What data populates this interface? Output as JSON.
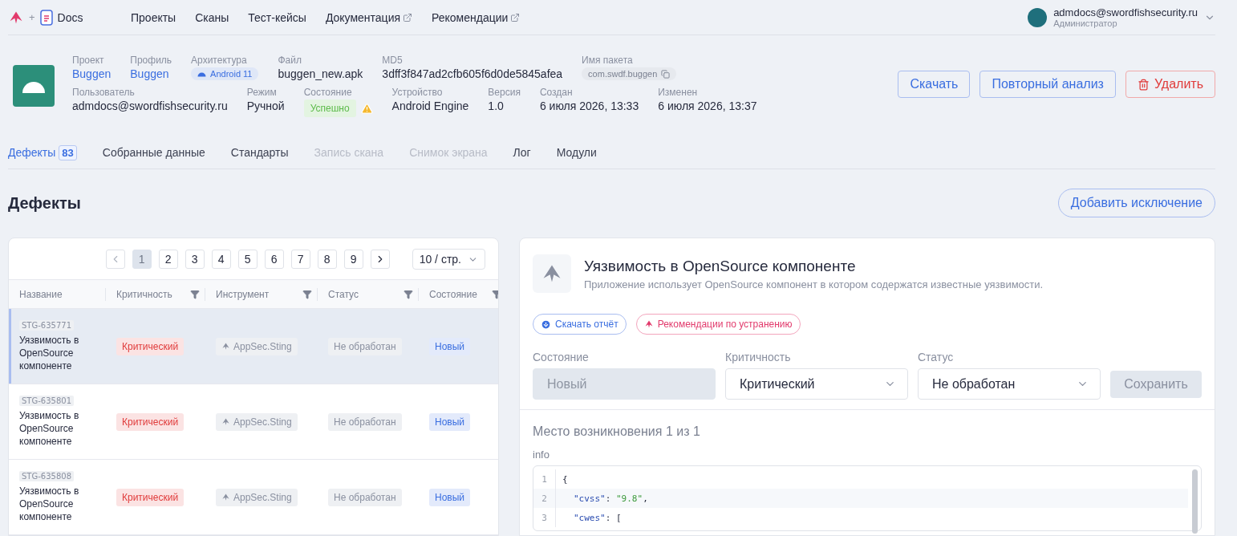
{
  "nav": {
    "separator": "+",
    "brand": "Docs",
    "items": [
      {
        "label": "Проекты",
        "external": false
      },
      {
        "label": "Сканы",
        "external": false
      },
      {
        "label": "Тест-кейсы",
        "external": false
      },
      {
        "label": "Документация",
        "external": true
      },
      {
        "label": "Рекомендации",
        "external": true
      }
    ],
    "user": {
      "email": "admdocs@swordfishsecurity.ru",
      "role": "Администратор"
    }
  },
  "scan": {
    "top": [
      {
        "label": "Проект",
        "value": "Buggen",
        "kind": "link"
      },
      {
        "label": "Профиль",
        "value": "Buggen",
        "kind": "link"
      },
      {
        "label": "Архитектура",
        "value": "Android 11",
        "kind": "platform"
      },
      {
        "label": "Файл",
        "value": "buggen_new.apk",
        "kind": "text"
      },
      {
        "label": "MD5",
        "value": "3dff3f847ad2cfb605f6d0de5845afea",
        "kind": "text"
      },
      {
        "label": "Имя пакета",
        "value": "com.swdf.buggen",
        "kind": "package"
      }
    ],
    "bottom": [
      {
        "label": "Пользователь",
        "value": "admdocs@swordfishsecurity.ru",
        "kind": "text"
      },
      {
        "label": "Режим",
        "value": "Ручной",
        "kind": "text"
      },
      {
        "label": "Состояние",
        "value": "Успешно",
        "kind": "status",
        "warning": true
      },
      {
        "label": "Устройство",
        "value": "Android Engine",
        "kind": "text"
      },
      {
        "label": "Версия",
        "value": "1.0",
        "kind": "text"
      },
      {
        "label": "Создан",
        "value": "6 июля 2026, 13:33",
        "kind": "text"
      },
      {
        "label": "Изменен",
        "value": "6 июля 2026, 13:37",
        "kind": "text"
      }
    ],
    "actions": [
      {
        "label": "Скачать",
        "kind": "primary"
      },
      {
        "label": "Повторный анализ",
        "kind": "primary"
      },
      {
        "label": "Удалить",
        "kind": "danger"
      }
    ]
  },
  "tabs": [
    {
      "label": "Дефекты",
      "count": "83",
      "selected": true,
      "disabled": false
    },
    {
      "label": "Собранные данные",
      "selected": false,
      "disabled": false
    },
    {
      "label": "Стандарты",
      "selected": false,
      "disabled": false
    },
    {
      "label": "Запись скана",
      "selected": false,
      "disabled": true
    },
    {
      "label": "Снимок экрана",
      "selected": false,
      "disabled": true
    },
    {
      "label": "Лог",
      "selected": false,
      "disabled": false
    },
    {
      "label": "Модули",
      "selected": false,
      "disabled": false
    }
  ],
  "section": {
    "title": "Дефекты",
    "add_button": "Добавить исключение"
  },
  "pagination": {
    "prev_disabled": true,
    "pages": [
      {
        "label": "1",
        "selected": true
      },
      {
        "label": "2",
        "selected": false
      },
      {
        "label": "3",
        "selected": false
      },
      {
        "label": "4",
        "selected": false
      },
      {
        "label": "5",
        "selected": false
      },
      {
        "label": "6",
        "selected": false
      },
      {
        "label": "7",
        "selected": false
      },
      {
        "label": "8",
        "selected": false
      },
      {
        "label": "9",
        "selected": false
      }
    ],
    "page_size": "10 / стр."
  },
  "table": {
    "columns": [
      {
        "label": "Название",
        "filter": false
      },
      {
        "label": "Критичность",
        "filter": true
      },
      {
        "label": "Инструмент",
        "filter": true
      },
      {
        "label": "Статус",
        "filter": true
      },
      {
        "label": "Состояние",
        "filter": true
      }
    ],
    "rows": [
      {
        "id": "STG-635771",
        "title": "Уязвимость в OpenSource компоненте",
        "severity": "Критический",
        "tool": "AppSec.Sting",
        "status": "Не обработан",
        "state": "Новый",
        "selected": true
      },
      {
        "id": "STG-635801",
        "title": "Уязвимость в OpenSource компоненте",
        "severity": "Критический",
        "tool": "AppSec.Sting",
        "status": "Не обработан",
        "state": "Новый",
        "selected": false
      },
      {
        "id": "STG-635808",
        "title": "Уязвимость в OpenSource компоненте",
        "severity": "Критический",
        "tool": "AppSec.Sting",
        "status": "Не обработан",
        "state": "Новый",
        "selected": false
      }
    ]
  },
  "detail": {
    "title": "Уязвимость в OpenSource компоненте",
    "description": "Приложение использует OpenSource компонент в котором содержатся известные уязвимости.",
    "links": [
      {
        "label": "Скачать отчёт",
        "kind": "download"
      },
      {
        "label": "Рекомендации по устранению",
        "kind": "recommend"
      }
    ],
    "fields": [
      {
        "label": "Состояние",
        "value": "Новый",
        "disabled": true
      },
      {
        "label": "Критичность",
        "value": "Критический",
        "disabled": false
      },
      {
        "label": "Статус",
        "value": "Не обработан",
        "disabled": false
      }
    ],
    "save": {
      "label": "Сохранить",
      "disabled": true
    },
    "occurrence": "Место возникновения 1 из 1",
    "code_label": "info",
    "code": [
      {
        "number": "1",
        "tokens": [
          {
            "kind": "punct",
            "text": "{"
          }
        ]
      },
      {
        "number": "2",
        "tokens": [
          {
            "kind": "key",
            "text": "\"cvss\""
          },
          {
            "kind": "punct",
            "text": ": "
          },
          {
            "kind": "string",
            "text": "\"9.8\""
          },
          {
            "kind": "punct",
            "text": ","
          }
        ]
      },
      {
        "number": "3",
        "tokens": [
          {
            "kind": "key",
            "text": "\"cwes\""
          },
          {
            "kind": "punct",
            "text": ": ["
          }
        ]
      }
    ]
  }
}
